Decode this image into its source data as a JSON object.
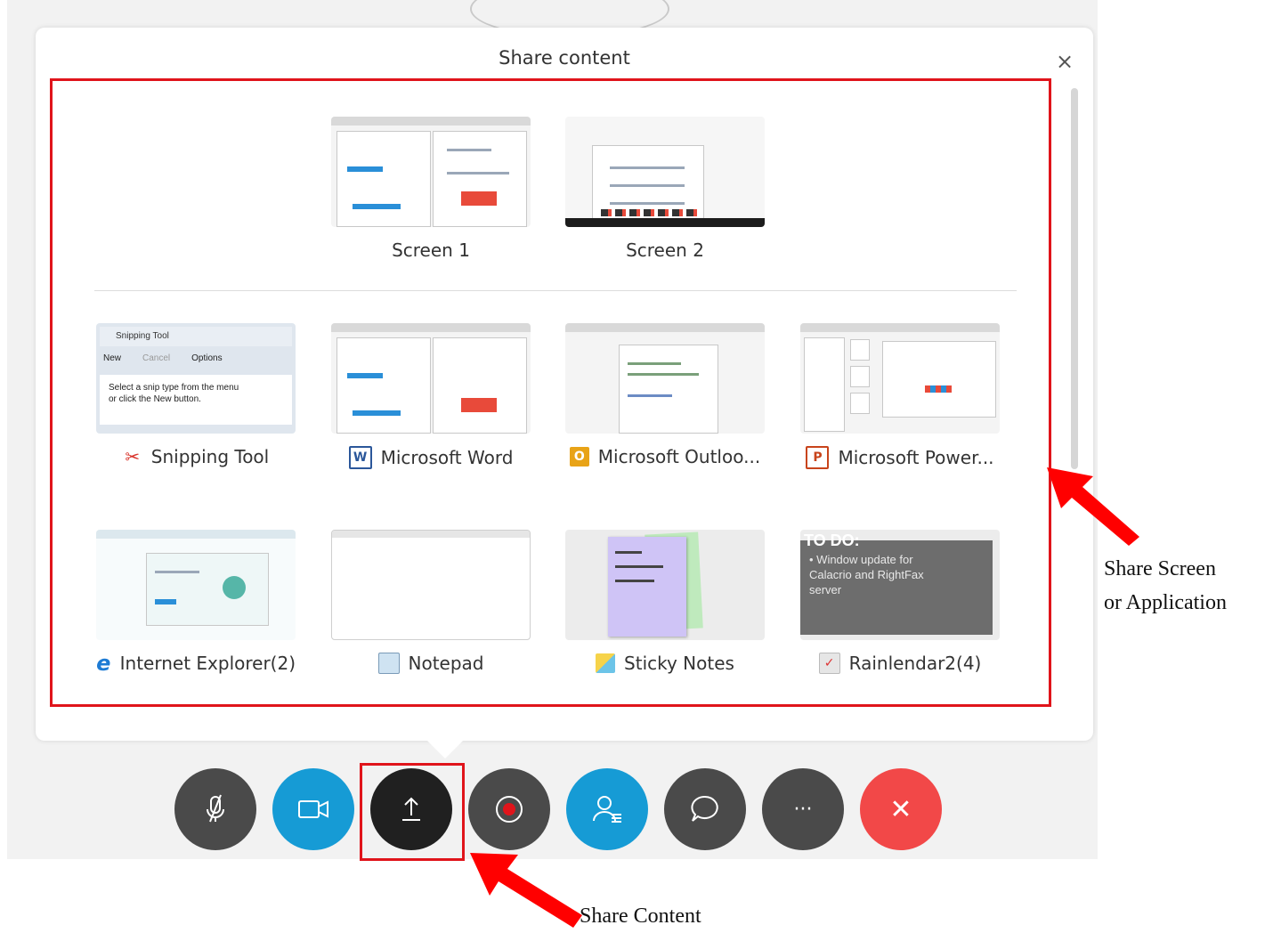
{
  "dialog": {
    "title": "Share content",
    "close_glyph": "×"
  },
  "screens": [
    {
      "label": "Screen 1"
    },
    {
      "label": "Screen 2"
    }
  ],
  "apps": [
    {
      "label": "Snipping Tool",
      "icon": "snipping-tool-icon"
    },
    {
      "label": "Microsoft Word",
      "icon": "word-icon",
      "icon_glyph": "W",
      "icon_color": "#2b579a"
    },
    {
      "label": "Microsoft Outloo...",
      "icon": "outlook-icon",
      "icon_glyph": "O",
      "icon_color": "#e8a317"
    },
    {
      "label": "Microsoft Power...",
      "icon": "powerpoint-icon",
      "icon_glyph": "P",
      "icon_color": "#c8441b"
    },
    {
      "label": "Internet Explorer(2)",
      "icon": "internet-explorer-icon",
      "icon_glyph": "e"
    },
    {
      "label": "Notepad",
      "icon": "notepad-icon"
    },
    {
      "label": "Sticky Notes",
      "icon": "sticky-notes-icon"
    },
    {
      "label": "Rainlendar2(4)",
      "icon": "rainlendar-icon"
    }
  ],
  "thumbs": {
    "snipping": {
      "title": "Snipping Tool",
      "new": "New",
      "cancel": "Cancel",
      "options": "Options",
      "hint1": "Select a snip type from the menu",
      "hint2": "or click the New button."
    },
    "rainlendar": {
      "heading": "TO DO:",
      "line1": "Window update for",
      "line2": "Calacrio and RightFax",
      "line3": "server"
    }
  },
  "toolbar": [
    {
      "name": "mute-button",
      "icon": "mic-off-icon"
    },
    {
      "name": "video-button",
      "icon": "camera-icon"
    },
    {
      "name": "share-content-button",
      "icon": "upload-icon"
    },
    {
      "name": "record-button",
      "icon": "record-icon"
    },
    {
      "name": "participants-button",
      "icon": "participants-icon"
    },
    {
      "name": "chat-button",
      "icon": "chat-icon"
    },
    {
      "name": "more-options-button",
      "icon": "more-icon",
      "glyph": "···"
    },
    {
      "name": "end-meeting-button",
      "icon": "close-icon",
      "glyph": "✕"
    }
  ],
  "annotations": {
    "share_screen_line1": "Share Screen",
    "share_screen_line2": "or Application",
    "share_content": "Share Content"
  },
  "colors": {
    "highlight_red": "#e0141b",
    "button_blue": "#169bd5",
    "button_dark": "#4a4a4a",
    "end_red": "#f24848"
  }
}
